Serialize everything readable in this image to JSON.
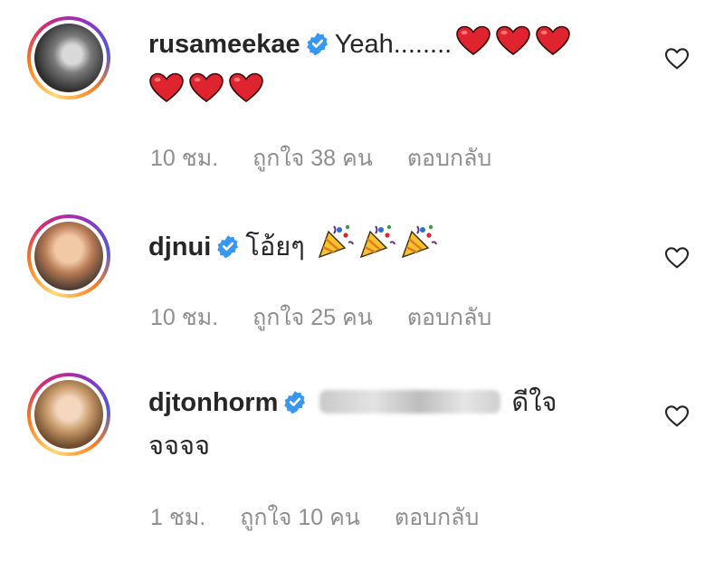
{
  "comments": [
    {
      "username": "rusameekae",
      "text": "Yeah........",
      "emojis_line1": 3,
      "emojis_line2": 3,
      "time": "10 ชม.",
      "likes": "ถูกใจ 38 คน",
      "reply": "ตอบกลับ"
    },
    {
      "username": "djnui",
      "text": "โอ้ยๆ",
      "emojis": 3,
      "time": "10 ชม.",
      "likes": "ถูกใจ 25 คน",
      "reply": "ตอบกลับ"
    },
    {
      "username": "djtonhorm",
      "text_after_blur": "ดีใจ",
      "text_line2": "จจจจ",
      "time": "1 ชม.",
      "likes": "ถูกใจ 10 คน",
      "reply": "ตอบกลับ"
    }
  ],
  "icons": {
    "verified": "verified-badge-icon",
    "like": "heart-outline-icon",
    "heart_emoji": "red-heart-emoji",
    "party_emoji": "party-popper-emoji"
  },
  "colors": {
    "verified": "#3897f0",
    "meta_text": "#8e8e8e",
    "heart_emoji": "#e0242f"
  }
}
